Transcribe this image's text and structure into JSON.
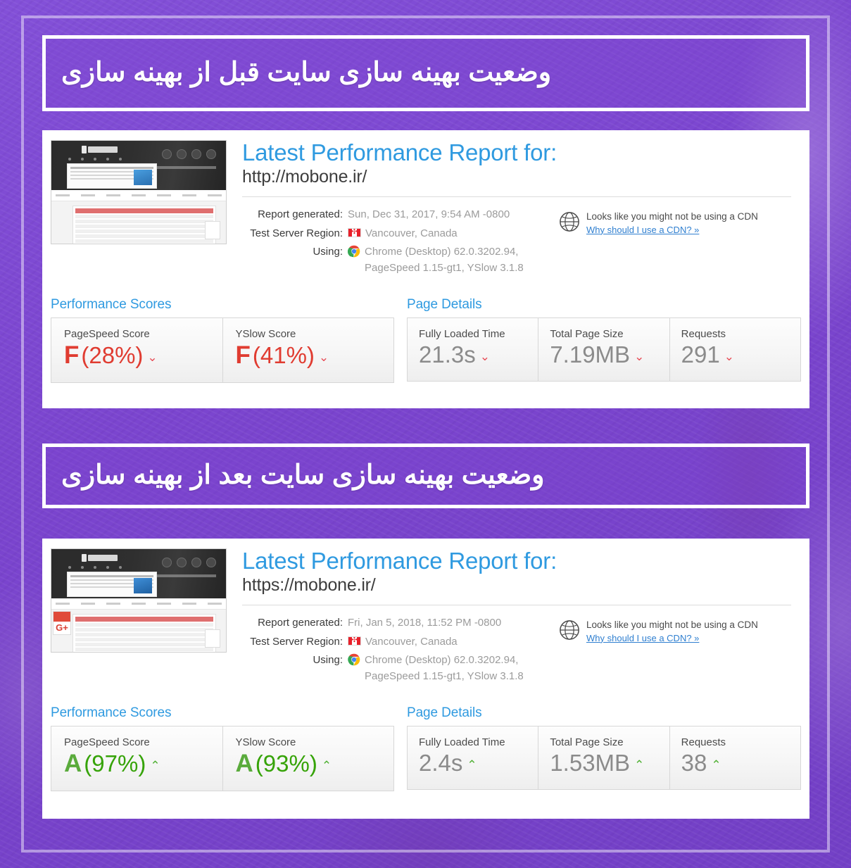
{
  "page": {
    "background_color": "#7e46d2",
    "frame_color": "#ffffff"
  },
  "banners": {
    "before": {
      "text": "وضعیت بهینه سازی سایت قبل از بهینه سازی"
    },
    "after": {
      "text": "وضعیت بهینه سازی سایت بعد از بهینه سازی"
    }
  },
  "reports": [
    {
      "id": "before",
      "title": "Latest Performance Report for:",
      "url": "http://mobone.ir/",
      "meta": {
        "report_generated_label": "Report generated:",
        "report_generated_value": "Sun, Dec 31, 2017, 9:54 AM -0800",
        "test_server_region_label": "Test Server Region:",
        "test_server_region_value": "Vancouver, Canada",
        "test_server_region_flag": "canada-flag-icon",
        "using_label": "Using:",
        "using_value_line1": "Chrome (Desktop) 62.0.3202.94,",
        "using_value_line2": "PageSpeed 1.15-gt1, YSlow 3.1.8",
        "using_icon": "chrome-icon"
      },
      "cdn": {
        "icon": "globe-icon",
        "message": "Looks like you might not be using a CDN",
        "link_text": "Why should I use a CDN? »"
      },
      "scores_section_title": "Performance Scores",
      "scores": [
        {
          "label": "PageSpeed Score",
          "grade": "F",
          "percent": "(28%)",
          "trend": "down",
          "color": "#e03c31"
        },
        {
          "label": "YSlow Score",
          "grade": "F",
          "percent": "(41%)",
          "trend": "down",
          "color": "#e03c31"
        }
      ],
      "details_section_title": "Page Details",
      "details": [
        {
          "label": "Fully Loaded Time",
          "value": "21.3s",
          "trend": "down"
        },
        {
          "label": "Total Page Size",
          "value": "7.19MB",
          "trend": "down"
        },
        {
          "label": "Requests",
          "value": "291",
          "trend": "down"
        }
      ]
    },
    {
      "id": "after",
      "title": "Latest Performance Report for:",
      "url": "https://mobone.ir/",
      "meta": {
        "report_generated_label": "Report generated:",
        "report_generated_value": "Fri, Jan 5, 2018, 11:52 PM -0800",
        "test_server_region_label": "Test Server Region:",
        "test_server_region_value": "Vancouver, Canada",
        "test_server_region_flag": "canada-flag-icon",
        "using_label": "Using:",
        "using_value_line1": "Chrome (Desktop) 62.0.3202.94,",
        "using_value_line2": "PageSpeed 1.15-gt1, YSlow 3.1.8",
        "using_icon": "chrome-icon"
      },
      "cdn": {
        "icon": "globe-icon",
        "message": "Looks like you might not be using a CDN",
        "link_text": "Why should I use a CDN? »"
      },
      "scores_section_title": "Performance Scores",
      "scores": [
        {
          "label": "PageSpeed Score",
          "grade": "A",
          "percent": "(97%)",
          "trend": "up",
          "color": "#5aab3c"
        },
        {
          "label": "YSlow Score",
          "grade": "A",
          "percent": "(93%)",
          "trend": "up",
          "color": "#5aab3c"
        }
      ],
      "details_section_title": "Page Details",
      "details": [
        {
          "label": "Fully Loaded Time",
          "value": "2.4s",
          "trend": "up"
        },
        {
          "label": "Total Page Size",
          "value": "1.53MB",
          "trend": "up"
        },
        {
          "label": "Requests",
          "value": "38",
          "trend": "up"
        }
      ]
    }
  ],
  "icons": {
    "caret_down": "⌄",
    "caret_up": "⌃",
    "maple_leaf": "🍁"
  }
}
